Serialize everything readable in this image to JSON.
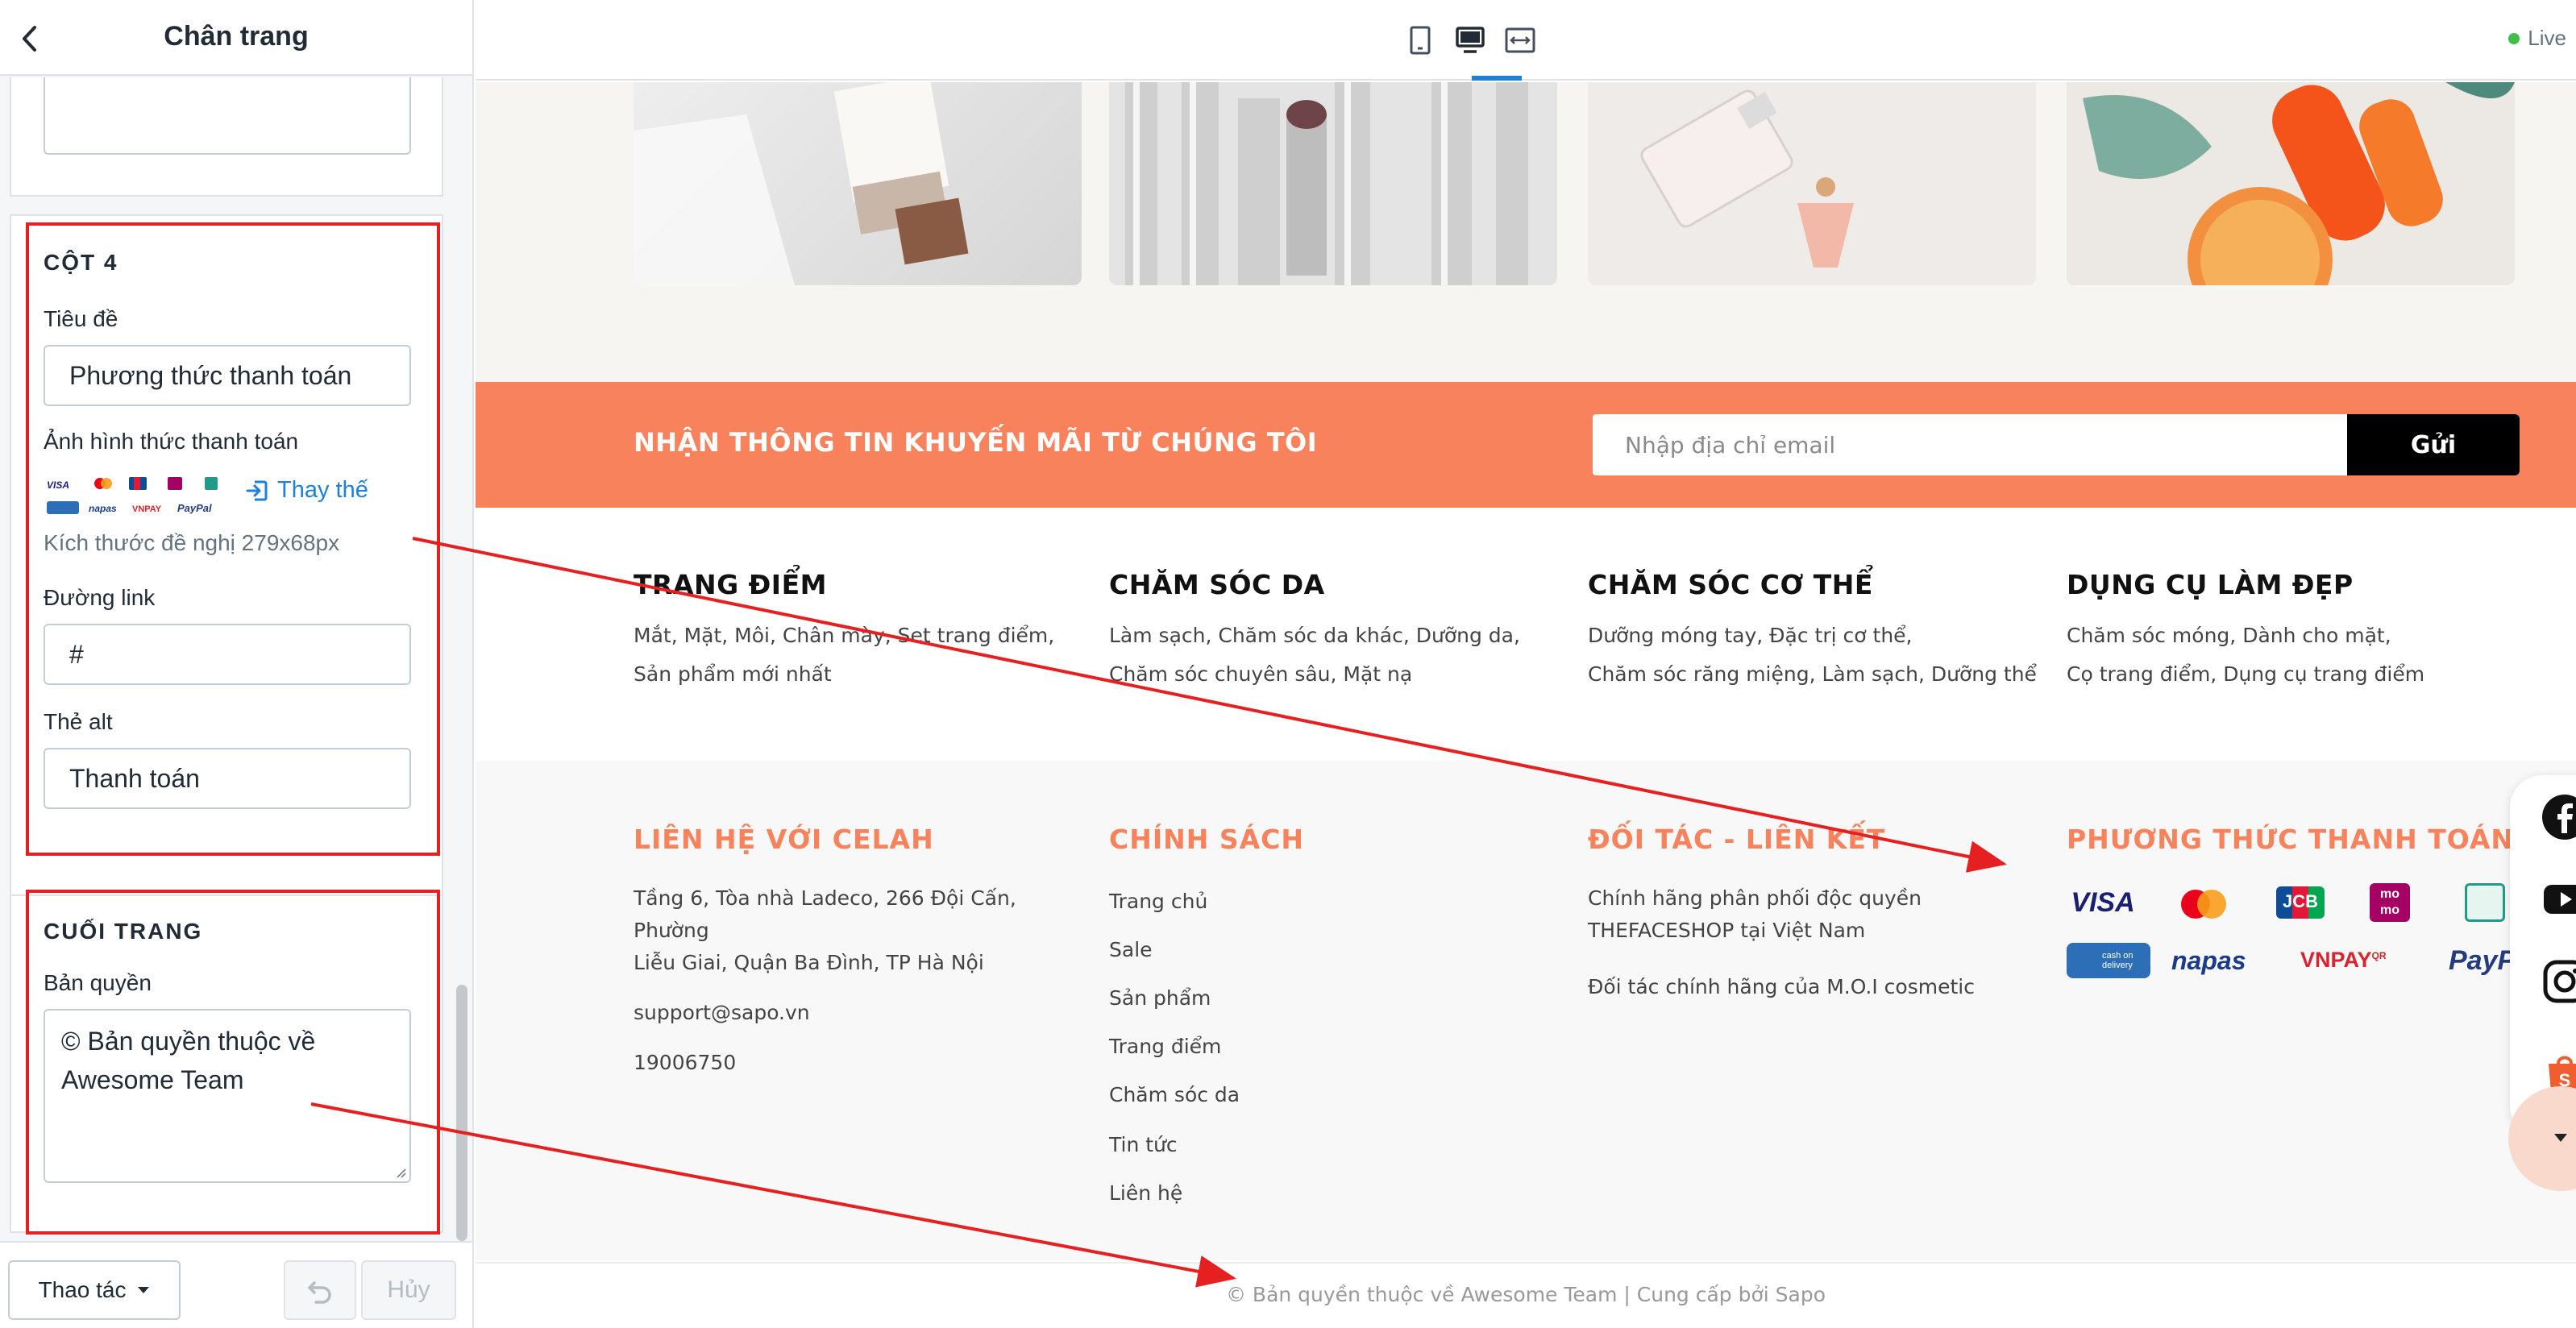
{
  "panel": {
    "title": "Chân trang",
    "col4": {
      "section_title": "CỘT 4",
      "title_label": "Tiêu đề",
      "title_value": "Phương thức thanh toán",
      "image_label": "Ảnh hình thức thanh toán",
      "replace_label": "Thay thế",
      "size_hint": "Kích thước đề nghị 279x68px",
      "link_label": "Đường link",
      "link_value": "#",
      "alt_label": "Thẻ alt",
      "alt_value": "Thanh toán"
    },
    "bottom": {
      "section_title": "CUỐI TRANG",
      "copyright_label": "Bản quyền",
      "copyright_value": "© Bản quyền thuộc về Awesome Team"
    },
    "footer": {
      "actions_label": "Thao tác",
      "cancel_label": "Hủy"
    }
  },
  "topbar": {
    "live_label": "Live"
  },
  "preview": {
    "newsletter": {
      "title": "NHẬN THÔNG TIN KHUYẾN MÃI TỪ CHÚNG TÔI",
      "placeholder": "Nhập địa chỉ email",
      "send_label": "Gửi"
    },
    "categories": [
      {
        "title": "TRANG ĐIỂM",
        "line1": "Mắt, Mặt, Môi, Chân mày, Set trang điểm,",
        "line2": "Sản phẩm mới nhất"
      },
      {
        "title": "CHĂM SÓC DA",
        "line1": "Làm sạch, Chăm sóc da khác, Dưỡng da,",
        "line2": "Chăm sóc chuyên sâu, Mặt nạ"
      },
      {
        "title": "CHĂM SÓC CƠ THỂ",
        "line1": "Dưỡng móng tay, Đặc trị cơ thể,",
        "line2": "Chăm sóc răng miệng, Làm sạch, Dưỡng thể"
      },
      {
        "title": "DỤNG CỤ LÀM ĐẸP",
        "line1": "Chăm sóc móng, Dành cho mặt,",
        "line2": "Cọ trang điểm, Dụng cụ trang điểm"
      }
    ],
    "contact": {
      "title": "LIÊN HỆ VỚI CELAH",
      "address_line1": "Tầng 6, Tòa nhà Ladeco, 266 Đội Cấn, Phường",
      "address_line2": "Liễu Giai, Quận Ba Đình, TP Hà Nội",
      "email": "support@sapo.vn",
      "phone": "19006750"
    },
    "policy": {
      "title": "CHÍNH SÁCH",
      "links": [
        "Trang chủ",
        "Sale",
        "Sản phẩm",
        "Trang điểm",
        "Chăm sóc da",
        "Tin tức",
        "Liên hệ"
      ]
    },
    "partners": {
      "title": "ĐỐI TÁC - LIÊN KẾT",
      "line1": "Chính hãng phân phối độc quyền",
      "line2": "THEFACESHOP tại Việt Nam",
      "line3": "Đối tác chính hãng của M.O.I cosmetic"
    },
    "payment": {
      "title": "PHƯƠNG THỨC THANH TOÁN",
      "logos": {
        "visa": "VISA",
        "jcb": "JCB",
        "momo": "mo mo",
        "cod": "cash on delivery",
        "napas": "napas",
        "vnpay": "VNPAY",
        "vnpay_sup": "QR",
        "paypal": "PayPal"
      }
    },
    "copyright": "© Bản quyền thuộc về Awesome Team | Cung cấp bởi Sapo"
  },
  "colors": {
    "accent_orange": "#f7825c",
    "annotation_red": "#e62020",
    "link_blue": "#1f80d9",
    "live_green": "#3fbf4a"
  }
}
